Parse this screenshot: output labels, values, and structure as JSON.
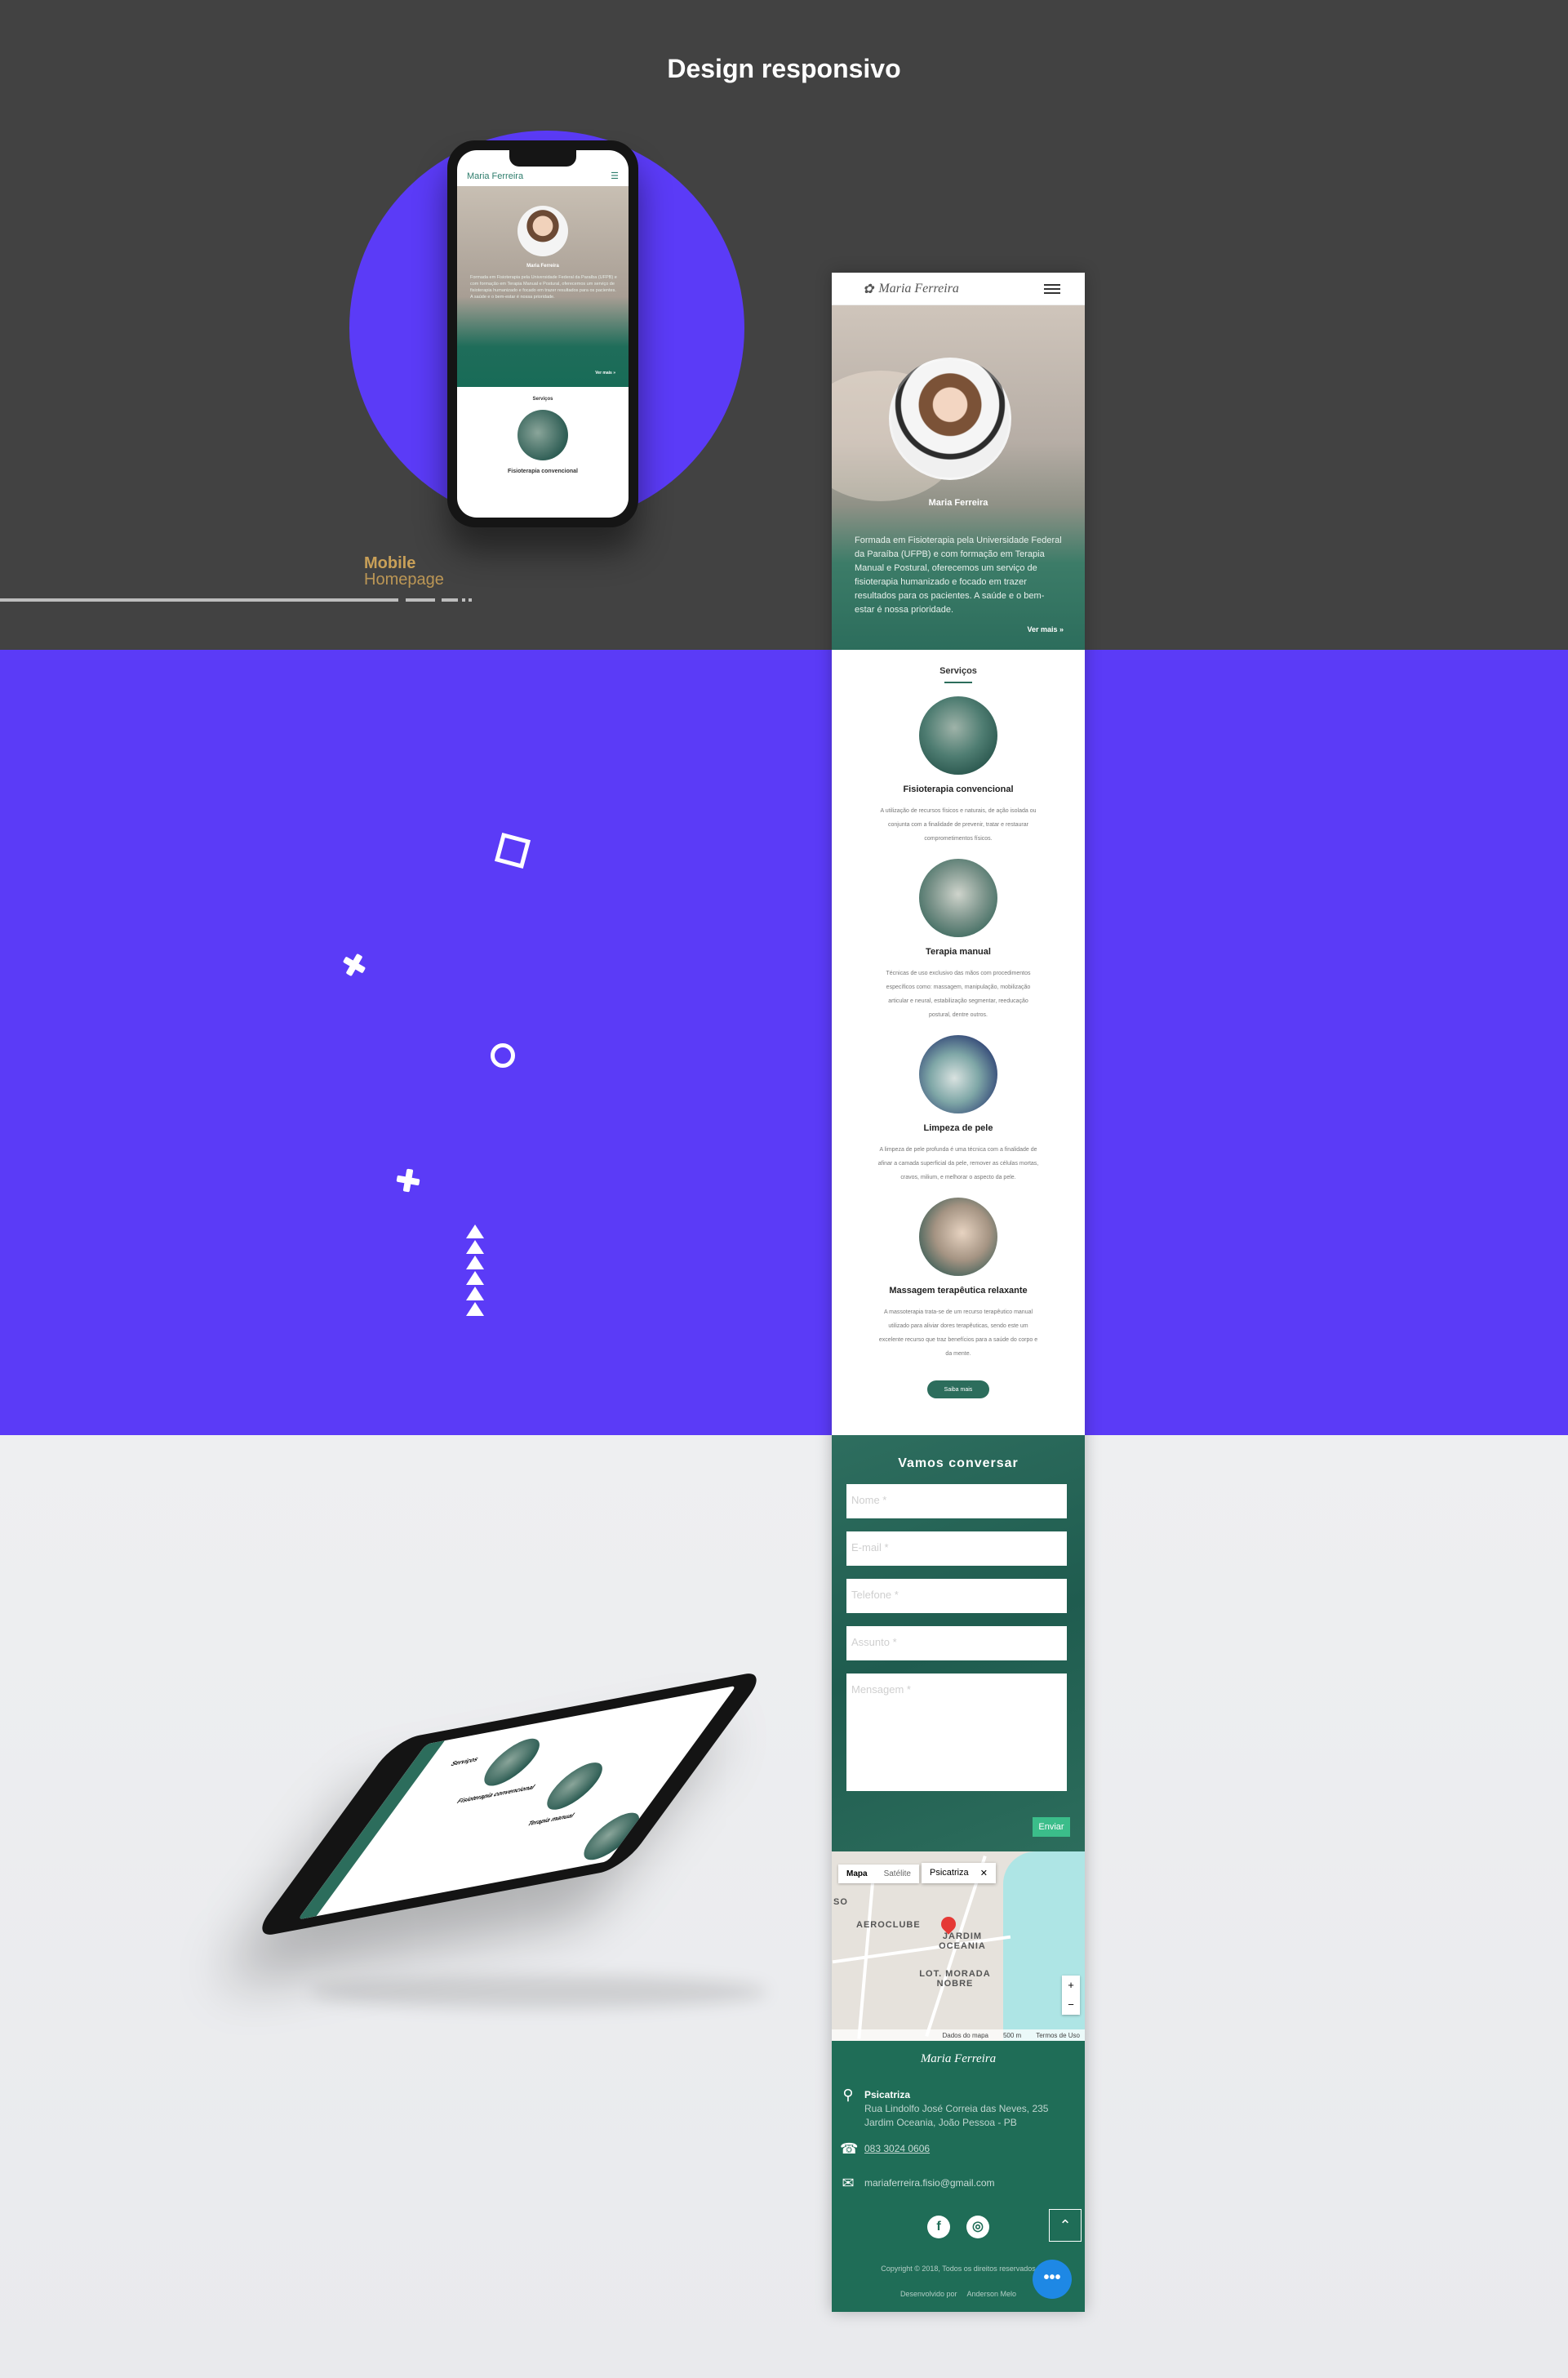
{
  "hero_title": "Design responsivo",
  "mobile_label": {
    "line1": "Mobile",
    "line2": "Homepage"
  },
  "mini_phone": {
    "brand": "Maria Ferreira",
    "name": "Maria Ferreira",
    "intro": "Formada em Fisioterapia pela Universidade Federal da Paraíba (UFPB) e com formação em Terapia Manual e Postural, oferecemos um serviço de fisioterapia humanizado e focado em trazer resultados para os pacientes. A saúde e o bem-estar é nossa prioridade.",
    "more": "Ver mais »",
    "services_title": "Serviços",
    "first_service": "Fisioterapia convencional"
  },
  "page": {
    "brand": "Maria Ferreira",
    "name": "Maria Ferreira",
    "intro": "Formada em Fisioterapia pela Universidade Federal da Paraíba (UFPB) e com formação em Terapia Manual e Postural, oferecemos um serviço de fisioterapia humanizado e focado em trazer resultados para os pacientes. A saúde e o bem-estar é nossa prioridade.",
    "more": "Ver mais »",
    "services_title": "Serviços",
    "services": [
      {
        "name": "Fisioterapia convencional",
        "desc": "A utilização de recursos físicos e naturais, de ação isolada ou conjunta com a finalidade de prevenir, tratar e restaurar comprometimentos físicos."
      },
      {
        "name": "Terapia manual",
        "desc": "Técnicas de uso exclusivo das mãos com procedimentos específicos como: massagem, manipulação, mobilização articular e neural, estabilização segmentar, reeducação postural, dentre outros."
      },
      {
        "name": "Limpeza de pele",
        "desc": "A limpeza de pele profunda é uma técnica com a finalidade de afinar a camada superficial da pele, remover as células mortas, cravos, milium, e melhorar o aspecto da pele."
      },
      {
        "name": "Massagem terapêutica relaxante",
        "desc": "A massoterapia trata-se de um recurso terapêutico manual utilizado para aliviar dores terapêuticas, sendo este um excelente recurso que traz benefícios para a saúde do corpo e da mente."
      }
    ],
    "button": "Saiba mais",
    "contact": {
      "title": "Vamos conversar",
      "name_ph": "Nome *",
      "email_ph": "E-mail *",
      "phone_ph": "Telefone *",
      "subject_ph": "Assunto *",
      "message_ph": "Mensagem *",
      "send": "Enviar"
    },
    "map": {
      "tab_map": "Mapa",
      "tab_satellite": "Satélite",
      "tooltip": "Psicatriza",
      "close": "✕",
      "area1": "AEROCLUBE",
      "area2": "JARDIM OCEANIA",
      "area3": "LOT. MORADA NOBRE",
      "so": "SO",
      "footer_data": "Dados do mapa",
      "footer_scale": "500 m",
      "footer_terms": "Termos de Uso",
      "zoom_in": "+",
      "zoom_out": "−"
    },
    "footer": {
      "brand": "Maria Ferreira",
      "company": "Psicatriza",
      "address1": "Rua Lindolfo José Correia das Neves, 235",
      "address2": "Jardim Oceania, João Pessoa - PB",
      "phone": "083 3024 0606",
      "email": "mariaferreira.fisio@gmail.com",
      "copyright": "Copyright © 2018, Todos os direitos reservados",
      "developer_label": "Desenvolvido por",
      "developer": "Anderson Melo",
      "up": "⌃",
      "chat": "•••",
      "fb": "f",
      "ig": "◎"
    }
  },
  "tilted_phone": {
    "services_title": "Serviços",
    "s1": "Fisioterapia convencional",
    "s2": "Terapia manual"
  }
}
